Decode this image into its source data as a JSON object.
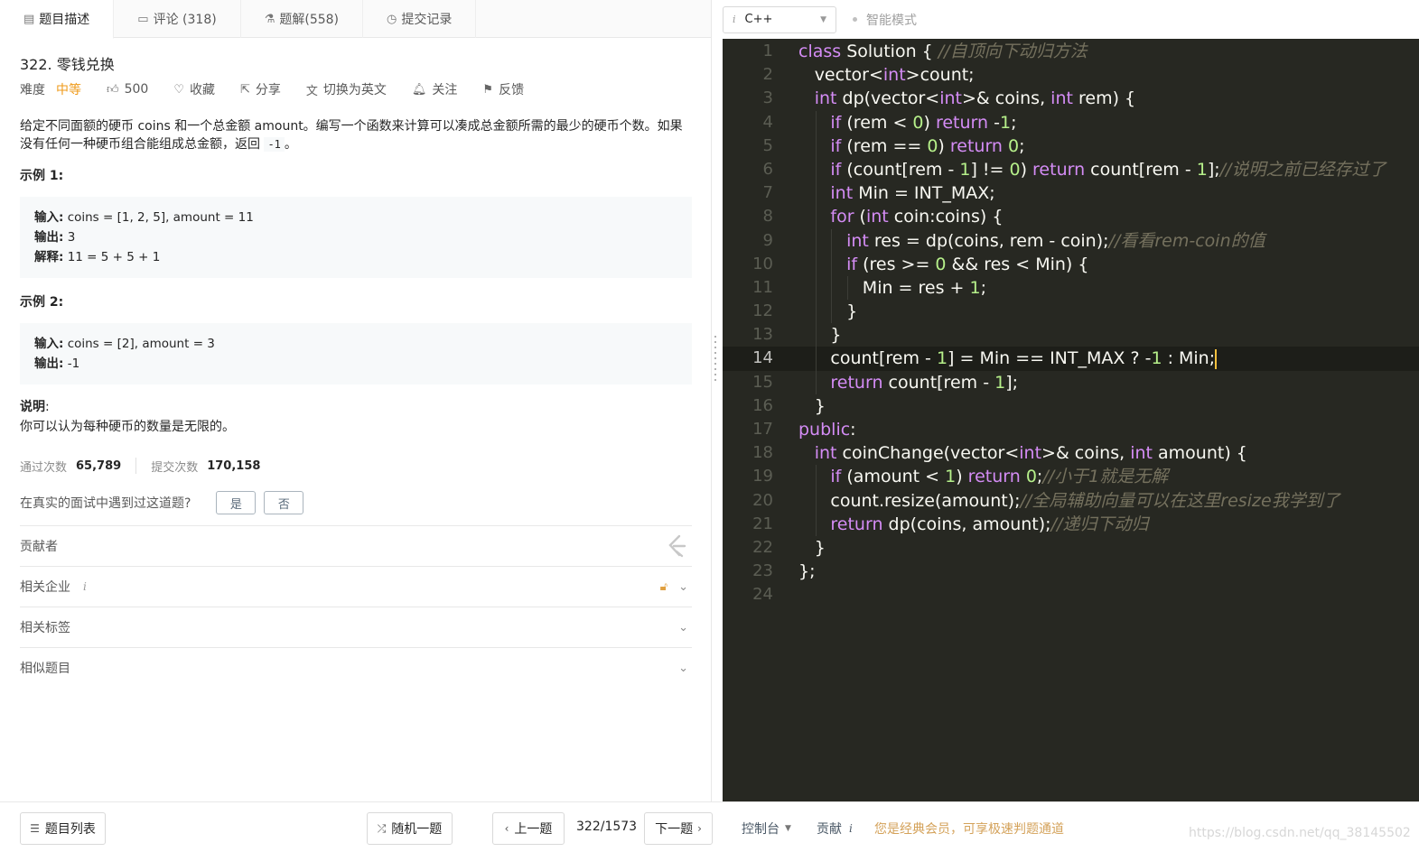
{
  "tabs": [
    {
      "label": "题目描述",
      "icon": "description-icon"
    },
    {
      "label": "评论 (318)",
      "icon": "comment-icon"
    },
    {
      "label": "题解(558)",
      "icon": "flask-icon"
    },
    {
      "label": "提交记录",
      "icon": "clock-icon"
    }
  ],
  "problem": {
    "title": "322. 零钱兑换",
    "difficulty_label": "难度",
    "difficulty": "中等",
    "likes": "500",
    "favorite": "收藏",
    "share": "分享",
    "switch_lang": "切换为英文",
    "follow": "关注",
    "feedback": "反馈",
    "statement_part1": "给定不同面额的硬币 coins 和一个总金额 amount。编写一个函数来计算可以凑成总金额所需的最少的硬币个数。如果没有任何一种硬币组合能组成总金额，返回 ",
    "statement_code": "-1",
    "statement_part2": "。",
    "example1_title": "示例 1:",
    "example1": {
      "input_label": "输入:",
      "input": " coins = [1, 2, 5], amount = 11",
      "output_label": "输出:",
      "output": " 3",
      "explain_label": "解释:",
      "explain": " 11 = 5 + 5 + 1"
    },
    "example2_title": "示例 2:",
    "example2": {
      "input_label": "输入:",
      "input": " coins = [2], amount = 3",
      "output_label": "输出:",
      "output": " -1"
    },
    "note_title": "说明",
    "note_colon": ":",
    "note_text": "你可以认为每种硬币的数量是无限的。",
    "accepted_label": "通过次数",
    "accepted": "65,789",
    "submitted_label": "提交次数",
    "submitted": "170,158",
    "seen_question": "在真实的面试中遇到过这道题?",
    "yes": "是",
    "no": "否"
  },
  "accordions": {
    "contributors": "贡献者",
    "companies": "相关企业",
    "companies_info": "i",
    "tags": "相关标签",
    "similar": "相似题目"
  },
  "editor": {
    "language": "C++",
    "language_info": "i",
    "smart_mode": "智能模式",
    "current_line": 14,
    "lines": [
      {
        "n": "1",
        "indent": 0,
        "tokens": [
          [
            "k",
            "class"
          ],
          [
            "p",
            " Solution { "
          ],
          [
            "c",
            "//自顶向下动归方法"
          ]
        ]
      },
      {
        "n": "2",
        "indent": 1,
        "tokens": [
          [
            "p",
            "vector<"
          ],
          [
            "k",
            "int"
          ],
          [
            "p",
            ">count;"
          ]
        ]
      },
      {
        "n": "3",
        "indent": 1,
        "tokens": [
          [
            "k",
            "int"
          ],
          [
            "p",
            " dp(vector<"
          ],
          [
            "k",
            "int"
          ],
          [
            "p",
            ">& coins, "
          ],
          [
            "k",
            "int"
          ],
          [
            "p",
            " rem) {"
          ]
        ]
      },
      {
        "n": "4",
        "indent": 2,
        "tokens": [
          [
            "k",
            "if"
          ],
          [
            "p",
            " (rem < "
          ],
          [
            "n",
            "0"
          ],
          [
            "p",
            ") "
          ],
          [
            "k",
            "return"
          ],
          [
            "p",
            " -"
          ],
          [
            "n",
            "1"
          ],
          [
            "p",
            ";"
          ]
        ]
      },
      {
        "n": "5",
        "indent": 2,
        "tokens": [
          [
            "k",
            "if"
          ],
          [
            "p",
            " (rem == "
          ],
          [
            "n",
            "0"
          ],
          [
            "p",
            ") "
          ],
          [
            "k",
            "return"
          ],
          [
            "p",
            " "
          ],
          [
            "n",
            "0"
          ],
          [
            "p",
            ";"
          ]
        ]
      },
      {
        "n": "6",
        "indent": 2,
        "tokens": [
          [
            "k",
            "if"
          ],
          [
            "p",
            " (count[rem - "
          ],
          [
            "n",
            "1"
          ],
          [
            "p",
            "] != "
          ],
          [
            "n",
            "0"
          ],
          [
            "p",
            ") "
          ],
          [
            "k",
            "return"
          ],
          [
            "p",
            " count[rem - "
          ],
          [
            "n",
            "1"
          ],
          [
            "p",
            "];"
          ],
          [
            "c",
            "//说明之前已经存过了"
          ]
        ]
      },
      {
        "n": "7",
        "indent": 2,
        "tokens": [
          [
            "k",
            "int"
          ],
          [
            "p",
            " Min = INT_MAX;"
          ]
        ]
      },
      {
        "n": "8",
        "indent": 2,
        "tokens": [
          [
            "k",
            "for"
          ],
          [
            "p",
            " ("
          ],
          [
            "k",
            "int"
          ],
          [
            "p",
            " coin:coins) {"
          ]
        ]
      },
      {
        "n": "9",
        "indent": 3,
        "tokens": [
          [
            "k",
            "int"
          ],
          [
            "p",
            " res = dp(coins, rem - coin);"
          ],
          [
            "c",
            "//看看rem-coin的值"
          ]
        ]
      },
      {
        "n": "10",
        "indent": 3,
        "tokens": [
          [
            "k",
            "if"
          ],
          [
            "p",
            " (res >= "
          ],
          [
            "n",
            "0"
          ],
          [
            "p",
            " && res < Min) {"
          ]
        ]
      },
      {
        "n": "11",
        "indent": 4,
        "tokens": [
          [
            "p",
            "Min = res + "
          ],
          [
            "n",
            "1"
          ],
          [
            "p",
            ";"
          ]
        ]
      },
      {
        "n": "12",
        "indent": 3,
        "tokens": [
          [
            "p",
            "}"
          ]
        ]
      },
      {
        "n": "13",
        "indent": 2,
        "tokens": [
          [
            "p",
            "}"
          ]
        ]
      },
      {
        "n": "14",
        "indent": 2,
        "tokens": [
          [
            "p",
            "count[rem - "
          ],
          [
            "n",
            "1"
          ],
          [
            "p",
            "] = Min == INT_MAX ? -"
          ],
          [
            "n",
            "1"
          ],
          [
            "p",
            " : Min;"
          ]
        ]
      },
      {
        "n": "15",
        "indent": 2,
        "tokens": [
          [
            "k",
            "return"
          ],
          [
            "p",
            " count[rem - "
          ],
          [
            "n",
            "1"
          ],
          [
            "p",
            "];"
          ]
        ]
      },
      {
        "n": "16",
        "indent": 1,
        "tokens": [
          [
            "p",
            "}"
          ]
        ]
      },
      {
        "n": "17",
        "indent": 0,
        "tokens": [
          [
            "k",
            "public"
          ],
          [
            "p",
            ":"
          ]
        ]
      },
      {
        "n": "18",
        "indent": 1,
        "tokens": [
          [
            "k",
            "int"
          ],
          [
            "p",
            " coinChange(vector<"
          ],
          [
            "k",
            "int"
          ],
          [
            "p",
            ">& coins, "
          ],
          [
            "k",
            "int"
          ],
          [
            "p",
            " amount) {"
          ]
        ]
      },
      {
        "n": "19",
        "indent": 2,
        "tokens": [
          [
            "k",
            "if"
          ],
          [
            "p",
            " (amount < "
          ],
          [
            "n",
            "1"
          ],
          [
            "p",
            ") "
          ],
          [
            "k",
            "return"
          ],
          [
            "p",
            " "
          ],
          [
            "n",
            "0"
          ],
          [
            "p",
            ";"
          ],
          [
            "c",
            "//小于1就是无解"
          ]
        ]
      },
      {
        "n": "20",
        "indent": 2,
        "tokens": [
          [
            "p",
            "count.resize(amount);"
          ],
          [
            "c",
            "//全局辅助向量可以在这里resize我学到了"
          ]
        ]
      },
      {
        "n": "21",
        "indent": 2,
        "tokens": [
          [
            "k",
            "return"
          ],
          [
            "p",
            " dp(coins, amount);"
          ],
          [
            "c",
            "//递归下动归"
          ]
        ]
      },
      {
        "n": "22",
        "indent": 1,
        "tokens": [
          [
            "p",
            "}"
          ]
        ]
      },
      {
        "n": "23",
        "indent": 0,
        "tokens": [
          [
            "p",
            "};"
          ]
        ]
      },
      {
        "n": "24",
        "indent": 0,
        "tokens": []
      }
    ]
  },
  "bottom": {
    "problem_list": "题目列表",
    "random": "随机一题",
    "prev": "上一题",
    "page": "322/1573",
    "next": "下一题",
    "console": "控制台",
    "contribute": "贡献",
    "contribute_info": "i",
    "vip_notice": "您是经典会员，可享极速判题通道",
    "watermark": "https://blog.csdn.net/qq_38145502"
  },
  "colors": {
    "difficulty_medium": "#ef9a1a",
    "editor_bg": "#272822",
    "keyword": "#d48cf5",
    "number": "#b6f08a",
    "comment": "#75715e",
    "vip_text": "#d4a25a"
  }
}
